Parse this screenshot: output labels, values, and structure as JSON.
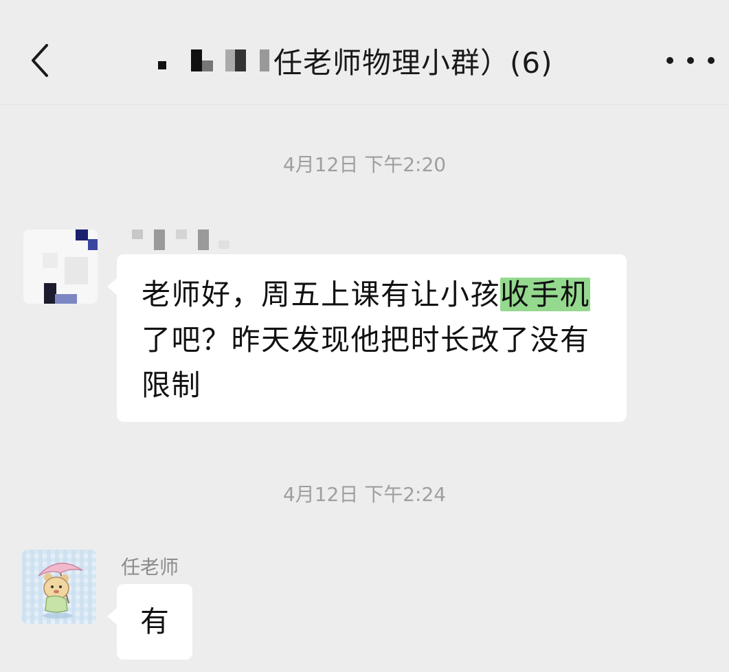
{
  "header": {
    "title": "任老师物理小群）(6)",
    "back_icon": "chevron-left-icon",
    "more_icon": "more-horizontal-icon"
  },
  "messages": [
    {
      "timestamp": "4月12日 下午2:20",
      "text_before": "老师好，周五上课有让小孩",
      "text_highlight": "收手机",
      "text_after": "了吧？昨天发现他把时长改了没有限制"
    },
    {
      "timestamp": "4月12日 下午2:24",
      "sender": "任老师",
      "text": "有"
    }
  ],
  "colors": {
    "background": "#ededed",
    "bubble": "#ffffff",
    "highlight": "#95d98f",
    "timestamp": "#9e9e9e"
  }
}
